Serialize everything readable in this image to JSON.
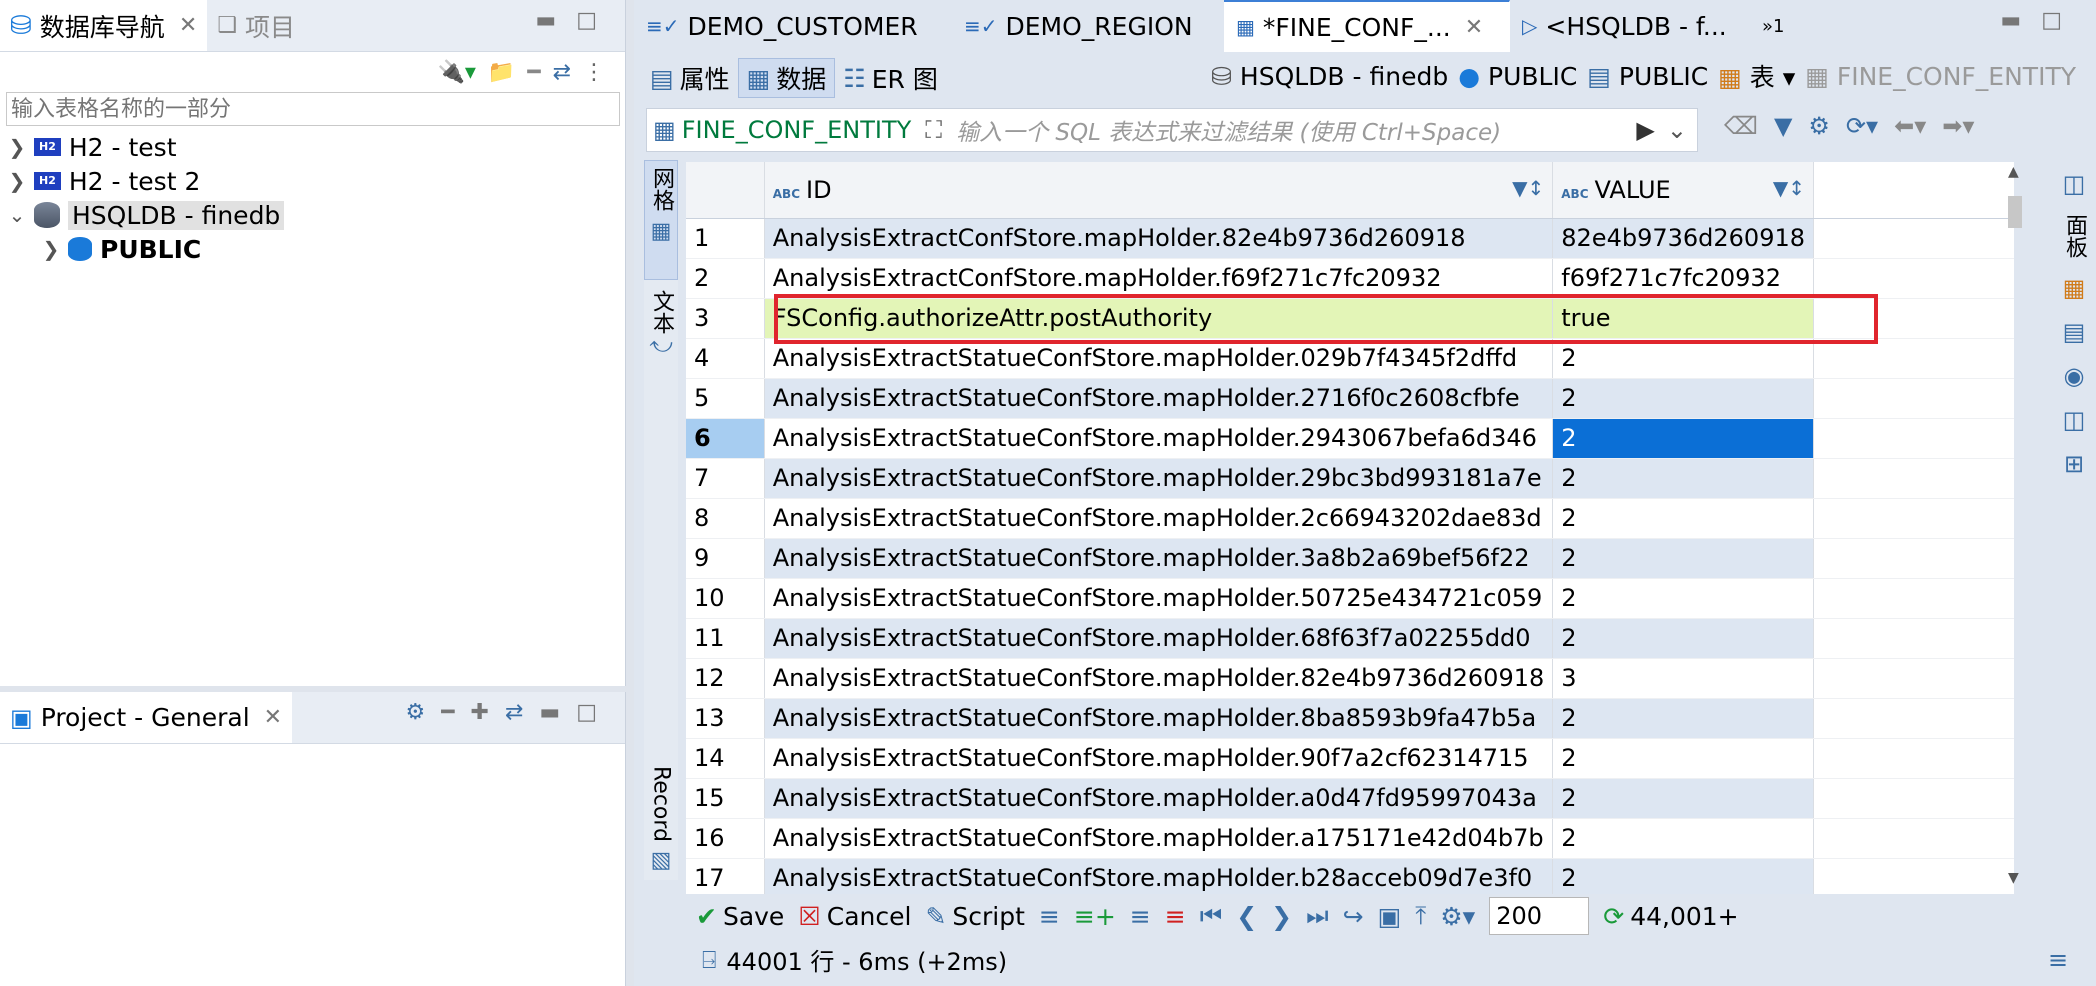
{
  "nav": {
    "tab_label": "数据库导航",
    "other_tab_label": "项目",
    "filter_placeholder": "输入表格名称的一部分",
    "tree": [
      {
        "label": "H2 - test",
        "badge": "H2"
      },
      {
        "label": "H2 - test 2",
        "badge": "H2"
      },
      {
        "label": "HSQLDB - finedb"
      },
      {
        "label": "PUBLIC"
      }
    ]
  },
  "project": {
    "tab_label": "Project - General"
  },
  "editor_tabs": [
    {
      "label": "DEMO_CUSTOMER"
    },
    {
      "label": "DEMO_REGION"
    },
    {
      "label": "*FINE_CONF_..."
    },
    {
      "label": "<HSQLDB - f..."
    },
    {
      "label": "»1"
    }
  ],
  "subtabs": [
    {
      "label": "属性"
    },
    {
      "label": "数据"
    },
    {
      "label": "ER 图"
    }
  ],
  "breadcrumbs": {
    "datasource": "HSQLDB - finedb",
    "catalog": "PUBLIC",
    "schema": "PUBLIC",
    "type": "表",
    "entity": "FINE_CONF_ENTITY"
  },
  "filter": {
    "entity": "FINE_CONF_ENTITY",
    "placeholder": "输入一个 SQL 表达式来过滤结果 (使用 Ctrl+Space)"
  },
  "side_tabs": {
    "grid": "网格",
    "text": "文本",
    "record": "Record",
    "panels": "面板"
  },
  "grid": {
    "columns": [
      "ID",
      "VALUE"
    ],
    "col_type_badge": "ABC",
    "rows": [
      {
        "n": "1",
        "id": "AnalysisExtractConfStore.mapHolder.82e4b9736d260918",
        "value": "82e4b9736d260918"
      },
      {
        "n": "2",
        "id": "AnalysisExtractConfStore.mapHolder.f69f271c7fc20932",
        "value": "f69f271c7fc20932"
      },
      {
        "n": "3",
        "id": "FSConfig.authorizeAttr.postAuthority",
        "value": "true"
      },
      {
        "n": "4",
        "id": "AnalysisExtractStatueConfStore.mapHolder.029b7f4345f2dffd",
        "value": "2"
      },
      {
        "n": "5",
        "id": "AnalysisExtractStatueConfStore.mapHolder.2716f0c2608cfbfe",
        "value": "2"
      },
      {
        "n": "6",
        "id": "AnalysisExtractStatueConfStore.mapHolder.2943067befa6d346",
        "value": "2"
      },
      {
        "n": "7",
        "id": "AnalysisExtractStatueConfStore.mapHolder.29bc3bd993181a7e",
        "value": "2"
      },
      {
        "n": "8",
        "id": "AnalysisExtractStatueConfStore.mapHolder.2c66943202dae83d",
        "value": "2"
      },
      {
        "n": "9",
        "id": "AnalysisExtractStatueConfStore.mapHolder.3a8b2a69bef56f22",
        "value": "2"
      },
      {
        "n": "10",
        "id": "AnalysisExtractStatueConfStore.mapHolder.50725e434721c059",
        "value": "2"
      },
      {
        "n": "11",
        "id": "AnalysisExtractStatueConfStore.mapHolder.68f63f7a02255dd0",
        "value": "2"
      },
      {
        "n": "12",
        "id": "AnalysisExtractStatueConfStore.mapHolder.82e4b9736d260918",
        "value": "3"
      },
      {
        "n": "13",
        "id": "AnalysisExtractStatueConfStore.mapHolder.8ba8593b9fa47b5a",
        "value": "2"
      },
      {
        "n": "14",
        "id": "AnalysisExtractStatueConfStore.mapHolder.90f7a2cf62314715",
        "value": "2"
      },
      {
        "n": "15",
        "id": "AnalysisExtractStatueConfStore.mapHolder.a0d47fd95997043a",
        "value": "2"
      },
      {
        "n": "16",
        "id": "AnalysisExtractStatueConfStore.mapHolder.a175171e42d04b7b",
        "value": "2"
      },
      {
        "n": "17",
        "id": "AnalysisExtractStatueConfStore.mapHolder.b28acceb09d7e3f0",
        "value": "2"
      }
    ],
    "highlighted_row": "3",
    "selected_row": "6"
  },
  "bottom": {
    "save": "Save",
    "cancel": "Cancel",
    "script": "Script",
    "fetch_size": "200",
    "row_count": "44,001+",
    "status": "44001 行 - 6ms (+2ms)"
  },
  "colors": {
    "highlight_row": "#e3f5b7",
    "selected_cell": "#0b6fd6",
    "red_box": "#e0252d",
    "accent": "#3a6ea5"
  }
}
